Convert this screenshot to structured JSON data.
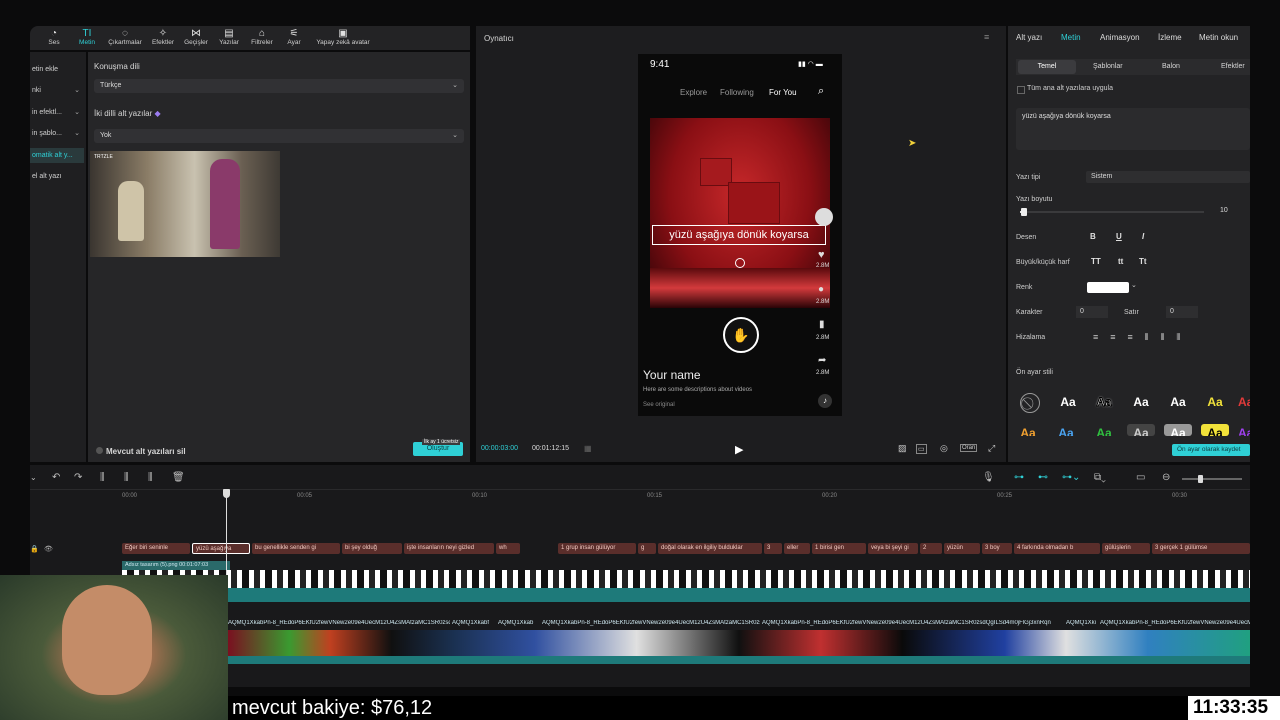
{
  "toolbar": {
    "items": [
      {
        "label": "Ses",
        "icon": "audio-icon"
      },
      {
        "label": "Metin",
        "icon": "text-icon"
      },
      {
        "label": "Çıkartmalar",
        "icon": "sticker-icon"
      },
      {
        "label": "Efektler",
        "icon": "effects-icon"
      },
      {
        "label": "Geçişler",
        "icon": "transitions-icon"
      },
      {
        "label": "Yazılar",
        "icon": "captions-icon"
      },
      {
        "label": "Filtreler",
        "icon": "filters-icon"
      },
      {
        "label": "Ayar",
        "icon": "adjust-icon"
      },
      {
        "label": "Yapay zekâ avatar",
        "icon": "ai-avatar-icon"
      }
    ]
  },
  "leftnav": {
    "items": [
      {
        "label": "etin ekle"
      },
      {
        "label": "nki"
      },
      {
        "label": "in efektl..."
      },
      {
        "label": "in şablo..."
      },
      {
        "label": "omatik alt y..."
      },
      {
        "label": "el alt yazı"
      }
    ]
  },
  "settings": {
    "speech_lang_label": "Konuşma dili",
    "speech_lang_value": "Türkçe",
    "bilingual_label": "İki dilli alt yazılar",
    "bilingual_value": "Yok",
    "thumb_badge": "TRTZLE",
    "delete_existing_label": "Mevcut alt yazıları sil",
    "create_button": "Oluştur",
    "create_badge": "İlk ay 1 ücretsiz"
  },
  "player": {
    "title": "Oynatıcı",
    "time_current": "00:00:03:00",
    "time_total": "00:01:12:15",
    "status_time": "9:41",
    "tabs": [
      "Explore",
      "Following",
      "For You"
    ],
    "caption_text": "yüzü aşağıya dönük koyarsa",
    "counts": [
      "2.8M",
      "2.8M",
      "2.8M",
      "2.8M"
    ],
    "username": "Your name",
    "description": "Here are some descriptions about videos",
    "see_original": "See original",
    "ratio_label": "Oran"
  },
  "rightpanel": {
    "tabs": [
      "Alt yazı",
      "Metin",
      "Animasyon",
      "İzleme",
      "Metin okun"
    ],
    "subtabs": [
      "Temel",
      "Şablonlar",
      "Balon",
      "Efektler"
    ],
    "apply_all_label": "Tüm ana alt yazılara uygula",
    "text_value": "yüzü aşağıya dönük koyarsa",
    "font_label": "Yazı tipi",
    "font_value": "Sistem",
    "font_size_label": "Yazı boyutu",
    "font_size_value": "10",
    "font_size_fraction": 0.02,
    "pattern_label": "Desen",
    "pattern_buttons": [
      "B",
      "U",
      "I"
    ],
    "case_label": "Büyük/küçük harf",
    "case_buttons": [
      "TT",
      "tt",
      "Tt"
    ],
    "color_label": "Renk",
    "color_value": "#ffffff",
    "char_label": "Karakter",
    "char_value": "0",
    "line_label": "Satır",
    "line_value": "0",
    "align_label": "Hizalama",
    "preset_label": "Ön ayar stili",
    "preset_sample": "Aa",
    "save_preset_button": "Ön ayar olarak kaydet"
  },
  "timeline": {
    "ticks": [
      "00:00",
      "00:05",
      "00:10",
      "00:15",
      "00:20",
      "00:25",
      "00:30"
    ],
    "captions": [
      "Eğer biri seninle",
      "yüzü aşağıya",
      "bu genellikle senden gi",
      "bi şey olduğ",
      "işte insanların neyi gizled",
      "wh",
      "1 grup insan gülüyor",
      "g",
      "doğal olarak en ilgiliy bulduklar",
      "3",
      "eller",
      "1 birisi gen",
      "veya bi şeyi gi",
      "2",
      "yüzün",
      "3 boy",
      "4 farkında olmadan b",
      "gülüşlerin",
      "3 gerçek 1 gülümse"
    ],
    "overlay_clip": "Adsız tasarım (5).png",
    "overlay_time": "00:01:07:03",
    "video_labels": [
      "AQMQ1XkabPn-8_REdoP6EKfU2fewVNew2e09e4UecM12U4ZsMAtzaMC1SR0zsdQgILSd4m0jFlGj3xnRqn",
      "AQMQ1Xkabf",
      "AQMQ1Xkab",
      "AQMQ1XkabPn-8_REdoP6EKfU2fewVNew2e09e4UecM12U4ZsMAtzaMC1SR0zsdQgILSd4m0jFlGj3xnRqn",
      "AQMQ1XkabPn-8_REdoP6EKfU2fewVNew2e09e4UecM12U4ZsMAtzaMC1SR0zsdQgILSd4m0jFlGj3xnRqn",
      "AQMQ1Xki",
      "AQMQ1XkabPn-8_REdoP6EKfU2fewVNew2e09e4UecM12U4ZsMAtzaMC1SR0zsdQgILSd4m0jFlGj3xnRqn"
    ]
  },
  "overlay": {
    "balance_text": "mevcut bakiye: $76,12",
    "clock": "11:33:35"
  },
  "colors": {
    "accent": "#2fd0d6",
    "caption_clip": "#5a2e2b",
    "video_track": "#1e7a7a"
  }
}
